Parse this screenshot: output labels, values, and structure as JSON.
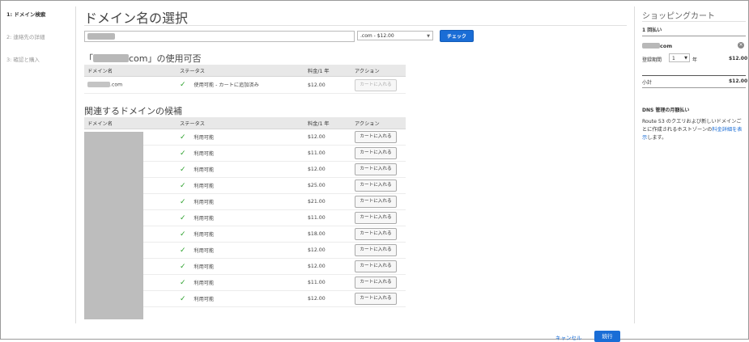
{
  "steps": [
    {
      "label": "1: ドメイン検索",
      "active": true
    },
    {
      "label": "2: 連絡先の詳細",
      "active": false
    },
    {
      "label": "3: 確認と購入",
      "active": false
    }
  ],
  "page_title": "ドメイン名の選択",
  "search": {
    "tld_selected": ".com - $12.00",
    "check_button": "チェック"
  },
  "availability": {
    "heading_prefix": "「",
    "heading_suffix": "com」の使用可否",
    "columns": [
      "ドメイン名",
      "ステータス",
      "料金/1 年",
      "アクション"
    ],
    "row": {
      "domain_suffix": ".com",
      "status": "使用可能 - カートに追加済み",
      "price": "$12.00",
      "action": "カートに入れる"
    }
  },
  "suggestions": {
    "heading": "関連するドメインの候補",
    "columns": [
      "ドメイン名",
      "ステータス",
      "料金/1 年",
      "アクション"
    ],
    "rows": [
      {
        "status": "利用可能",
        "price": "$12.00",
        "action": "カートに入れる"
      },
      {
        "status": "利用可能",
        "price": "$11.00",
        "action": "カートに入れる"
      },
      {
        "status": "利用可能",
        "price": "$12.00",
        "action": "カートに入れる"
      },
      {
        "status": "利用可能",
        "price": "$25.00",
        "action": "カートに入れる"
      },
      {
        "status": "利用可能",
        "price": "$21.00",
        "action": "カートに入れる"
      },
      {
        "status": "利用可能",
        "price": "$11.00",
        "action": "カートに入れる"
      },
      {
        "status": "利用可能",
        "price": "$18.00",
        "action": "カートに入れる"
      },
      {
        "status": "利用可能",
        "price": "$12.00",
        "action": "カートに入れる"
      },
      {
        "status": "利用可能",
        "price": "$12.00",
        "action": "カートに入れる"
      },
      {
        "status": "利用可能",
        "price": "$11.00",
        "action": "カートに入れる"
      },
      {
        "status": "利用可能",
        "price": "$12.00",
        "action": "カートに入れる"
      }
    ]
  },
  "cart": {
    "title": "ショッピングカート",
    "payment_label": "1 回払い",
    "item_suffix": "com",
    "period_label": "登録期間",
    "period_value": "1",
    "period_unit": "年",
    "item_price": "$12.00",
    "subtotal_label": "小計",
    "subtotal_price": "$12.00",
    "dns_title": "DNS 管理の月額払い",
    "dns_text_1": "Route 53 のクエリおよび新しいドメインごとに作成されるホストゾーンの",
    "dns_link": "料金詳細を表示",
    "dns_text_2": "します。"
  },
  "footer": {
    "cancel": "キャンセル",
    "next": "続行"
  },
  "colors": {
    "accent": "#1a6dd6",
    "check": "#2aa02a"
  }
}
